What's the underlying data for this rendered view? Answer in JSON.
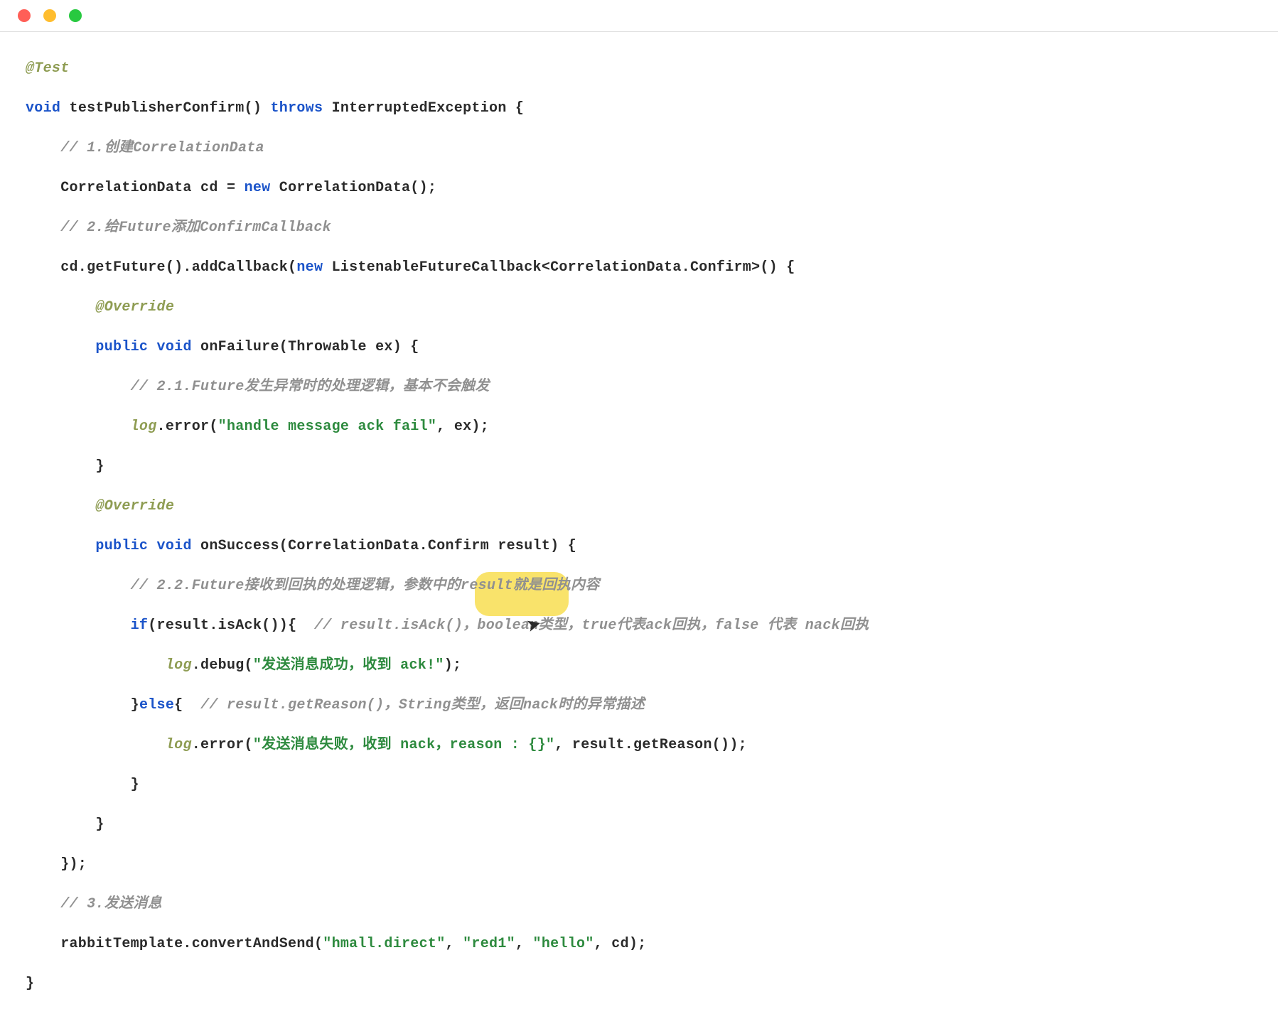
{
  "titlebar": {
    "close": "close",
    "minimize": "minimize",
    "maximize": "maximize"
  },
  "code": {
    "l1_anno": "@Test",
    "l2_kw1": "void",
    "l2_name": " testPublisherConfirm() ",
    "l2_kw2": "throws",
    "l2_rest": " InterruptedException {",
    "l3_comment": "    // 1.创建CorrelationData",
    "l4_a": "    CorrelationData cd = ",
    "l4_kw": "new",
    "l4_b": " CorrelationData();",
    "l5_comment": "    // 2.给Future添加ConfirmCallback",
    "l6_a": "    cd.getFuture().addCallback(",
    "l6_kw": "new",
    "l6_b": " ListenableFutureCallback<CorrelationData.Confirm>() {",
    "l7_anno": "        @Override",
    "l8_kw1": "        public",
    "l8_kw2": " void",
    "l8_rest": " onFailure(Throwable ex) {",
    "l9_comment": "            // 2.1.Future发生异常时的处理逻辑，基本不会触发",
    "l10_pre": "            ",
    "l10_log": "log",
    "l10_a": ".error(",
    "l10_str": "\"handle message ack fail\"",
    "l10_b": ", ex);",
    "l11": "        }",
    "l12_anno": "        @Override",
    "l13_kw1": "        public",
    "l13_kw2": " void",
    "l13_rest": " onSuccess(CorrelationData.Confirm result) {",
    "l14_comment": "            // 2.2.Future接收到回执的处理逻辑，参数中的result就是回执内容",
    "l15_pre": "            ",
    "l15_kw": "if",
    "l15_a": "(result.isAck()){  ",
    "l15_comment": "// result.isAck()，boolean类型，true代表ack回执，false 代表 nack回执",
    "l16_pre": "                ",
    "l16_log": "log",
    "l16_a": ".debug(",
    "l16_str": "\"发送消息成功，收到 ack!\"",
    "l16_b": ");",
    "l17_a": "            }",
    "l17_kw": "else",
    "l17_b": "{  ",
    "l17_comment": "// result.getReason()，String类型，返回nack时的异常描述",
    "l18_pre": "                ",
    "l18_log": "log",
    "l18_a": ".error(",
    "l18_str": "\"发送消息失败，收到 nack，reason : {}\"",
    "l18_b": ", result.getReason());",
    "l19": "            }",
    "l20": "        }",
    "l21": "    });",
    "l22_comment": "    // 3.发送消息",
    "l23_a": "    rabbitTemplate.convertAndSend(",
    "l23_s1": "\"hmall.direct\"",
    "l23_c1": ", ",
    "l23_s2": "\"red1\"",
    "l23_c2": ", ",
    "l23_s3": "\"hello\"",
    "l23_b": ", cd);",
    "l24": "}"
  },
  "cursor_glyph": "↖"
}
